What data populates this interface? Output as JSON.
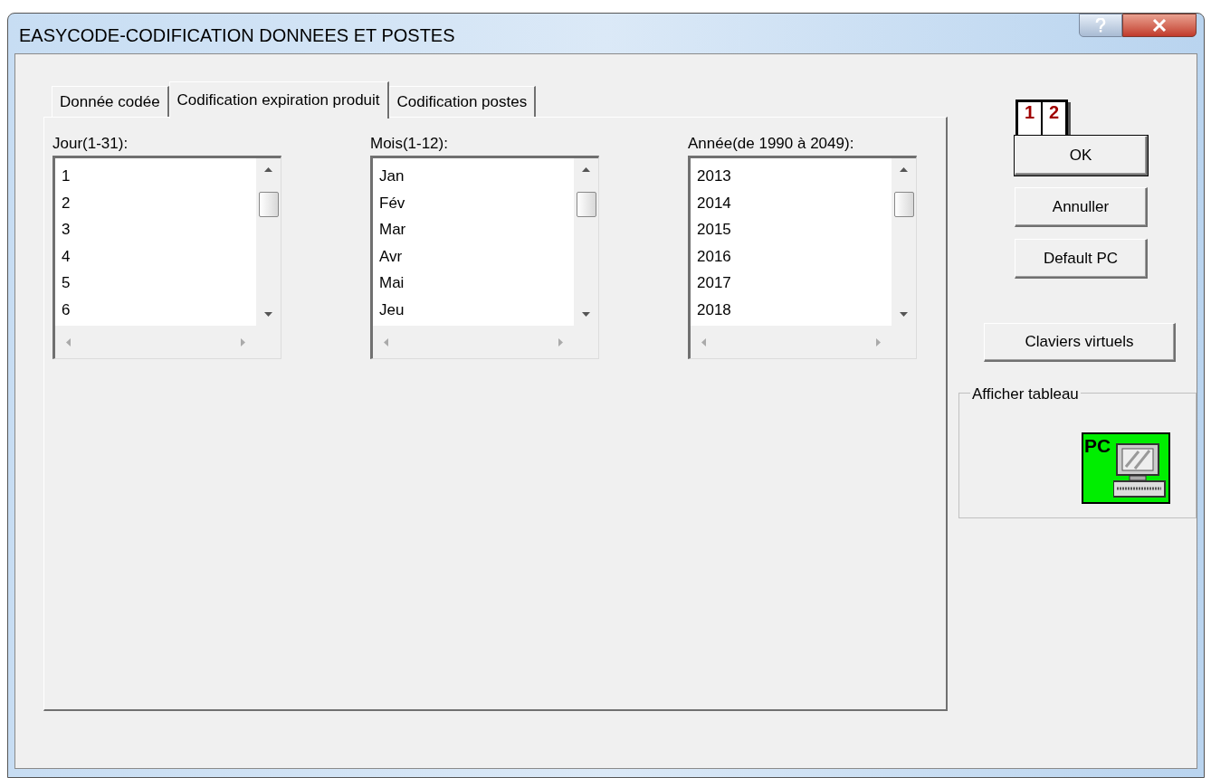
{
  "window": {
    "title": "EASYCODE-CODIFICATION DONNEES ET POSTES"
  },
  "tabs": [
    {
      "label": "Donnée codée",
      "selected": false
    },
    {
      "label": "Codification expiration produit",
      "selected": true
    },
    {
      "label": "Codification postes",
      "selected": false
    }
  ],
  "lists": [
    {
      "label": "Jour(1-31):",
      "items": [
        "1",
        "2",
        "3",
        "4",
        "5",
        "6"
      ]
    },
    {
      "label": "Mois(1-12):",
      "items": [
        "Jan",
        "Fév",
        "Mar",
        "Avr",
        "Mai",
        "Jeu"
      ]
    },
    {
      "label": "Année(de 1990 à 2049):",
      "items": [
        "2013",
        "2014",
        "2015",
        "2016",
        "2017",
        "2018"
      ]
    }
  ],
  "calendar_icon_digits": [
    "1",
    "2"
  ],
  "buttons": [
    "OK",
    "Annuller",
    "Default PC"
  ],
  "virtual_keyboards_button": "Claviers virtuels",
  "group": {
    "title": "Afficher tableau",
    "icon_text": "PC"
  }
}
